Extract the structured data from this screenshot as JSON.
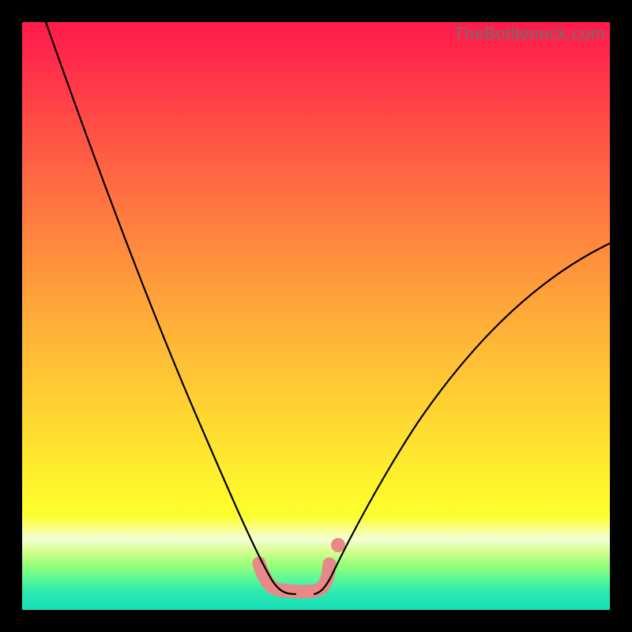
{
  "watermark": "TheBottleneck.com",
  "colors": {
    "frame": "#000000",
    "curve": "#000000",
    "highlight": "#e98888",
    "gradient_top": "#ff1a4b",
    "gradient_bottom": "#17e0b8"
  },
  "chart_data": {
    "type": "line",
    "title": "",
    "xlabel": "",
    "ylabel": "",
    "xlim": [
      0,
      100
    ],
    "ylim": [
      0,
      100
    ],
    "note": "No axis ticks or numeric labels are visible; x and y values below are estimated from pixel positions on a 0–100 normalized scale (0,0 bottom-left).",
    "series": [
      {
        "name": "left-curve",
        "x": [
          4,
          8,
          12,
          16,
          20,
          24,
          28,
          32,
          36,
          40,
          42,
          44,
          46
        ],
        "y": [
          100,
          89,
          78,
          67,
          56,
          45,
          35,
          25,
          16,
          8,
          5,
          3.5,
          3
        ]
      },
      {
        "name": "right-curve",
        "x": [
          50,
          52,
          54,
          58,
          62,
          66,
          70,
          76,
          82,
          88,
          94,
          100
        ],
        "y": [
          3,
          4,
          6,
          12,
          19,
          26,
          32,
          40,
          47,
          53,
          58,
          62
        ]
      },
      {
        "name": "salmon-highlight",
        "x": [
          40.4,
          41.5,
          43,
          45,
          47,
          49,
          50.5,
          51.5,
          52.3
        ],
        "y": [
          8,
          5.5,
          3.7,
          3.1,
          3.1,
          3.3,
          4.1,
          5.8,
          8
        ]
      }
    ],
    "extra_points": [
      {
        "name": "salmon-dot",
        "x": 53.8,
        "y": 11.2
      }
    ]
  }
}
